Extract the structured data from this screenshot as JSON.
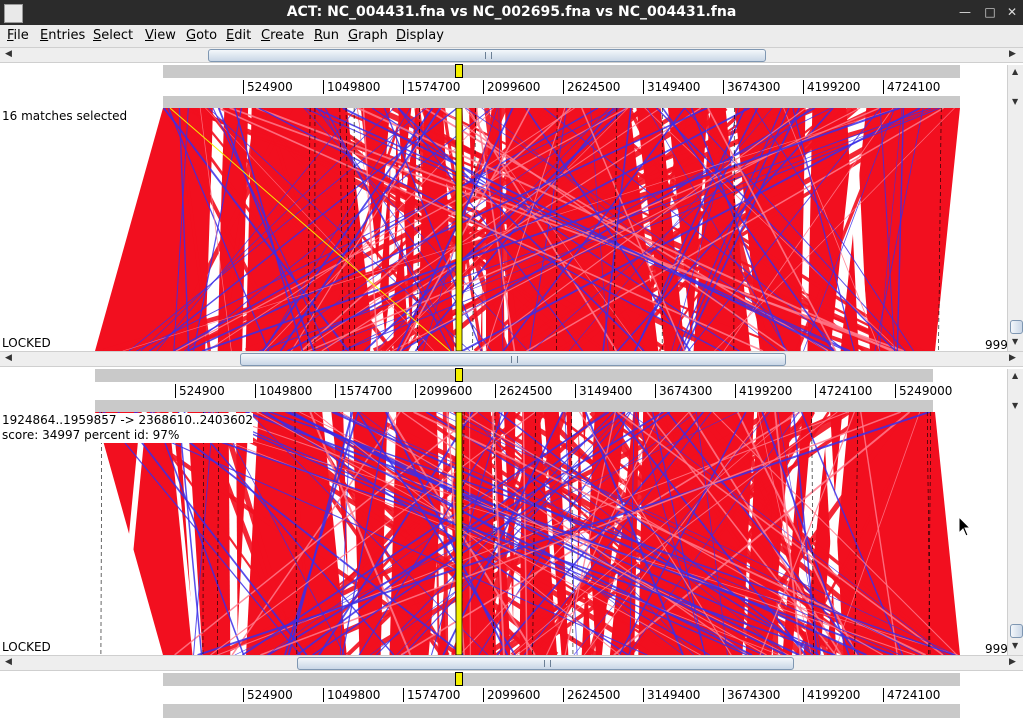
{
  "window": {
    "title": "ACT: NC_004431.fna vs NC_002695.fna vs NC_004431.fna"
  },
  "menu": [
    {
      "label": "File",
      "accel": "F"
    },
    {
      "label": "Entries",
      "accel": "E"
    },
    {
      "label": "Select",
      "accel": "S"
    },
    {
      "label": "View",
      "accel": "V"
    },
    {
      "label": "Goto",
      "accel": "G"
    },
    {
      "label": "Edit",
      "accel": "E"
    },
    {
      "label": "Create",
      "accel": "C"
    },
    {
      "label": "Run",
      "accel": "R"
    },
    {
      "label": "Graph",
      "accel": "G"
    },
    {
      "label": "Display",
      "accel": "D"
    }
  ],
  "rulers": {
    "top": [
      "524900",
      "1049800",
      "1574700",
      "2099600",
      "2624500",
      "3149400",
      "3674300",
      "4199200",
      "4724100"
    ],
    "middle": [
      "524900",
      "1049800",
      "1574700",
      "2099600",
      "2624500",
      "3149400",
      "3674300",
      "4199200",
      "4724100",
      "5249000"
    ],
    "bottom": [
      "524900",
      "1049800",
      "1574700",
      "2099600",
      "2624500",
      "3149400",
      "3674300",
      "4199200",
      "4724100"
    ]
  },
  "panels": {
    "top": {
      "status": "16 matches selected",
      "lock": "LOCKED",
      "cutoff": "999"
    },
    "bottom": {
      "info_line1": "1924864..1959857 -> 2368610..2403602",
      "info_line2": "score: 34997  percent id: 97%",
      "lock": "LOCKED",
      "cutoff": "999"
    }
  },
  "colors": {
    "forward_match": "#f20f1f",
    "reverse_match": "#3a2ee8",
    "selected_match": "#f4f000",
    "ruler_band": "#c9c9c9"
  }
}
